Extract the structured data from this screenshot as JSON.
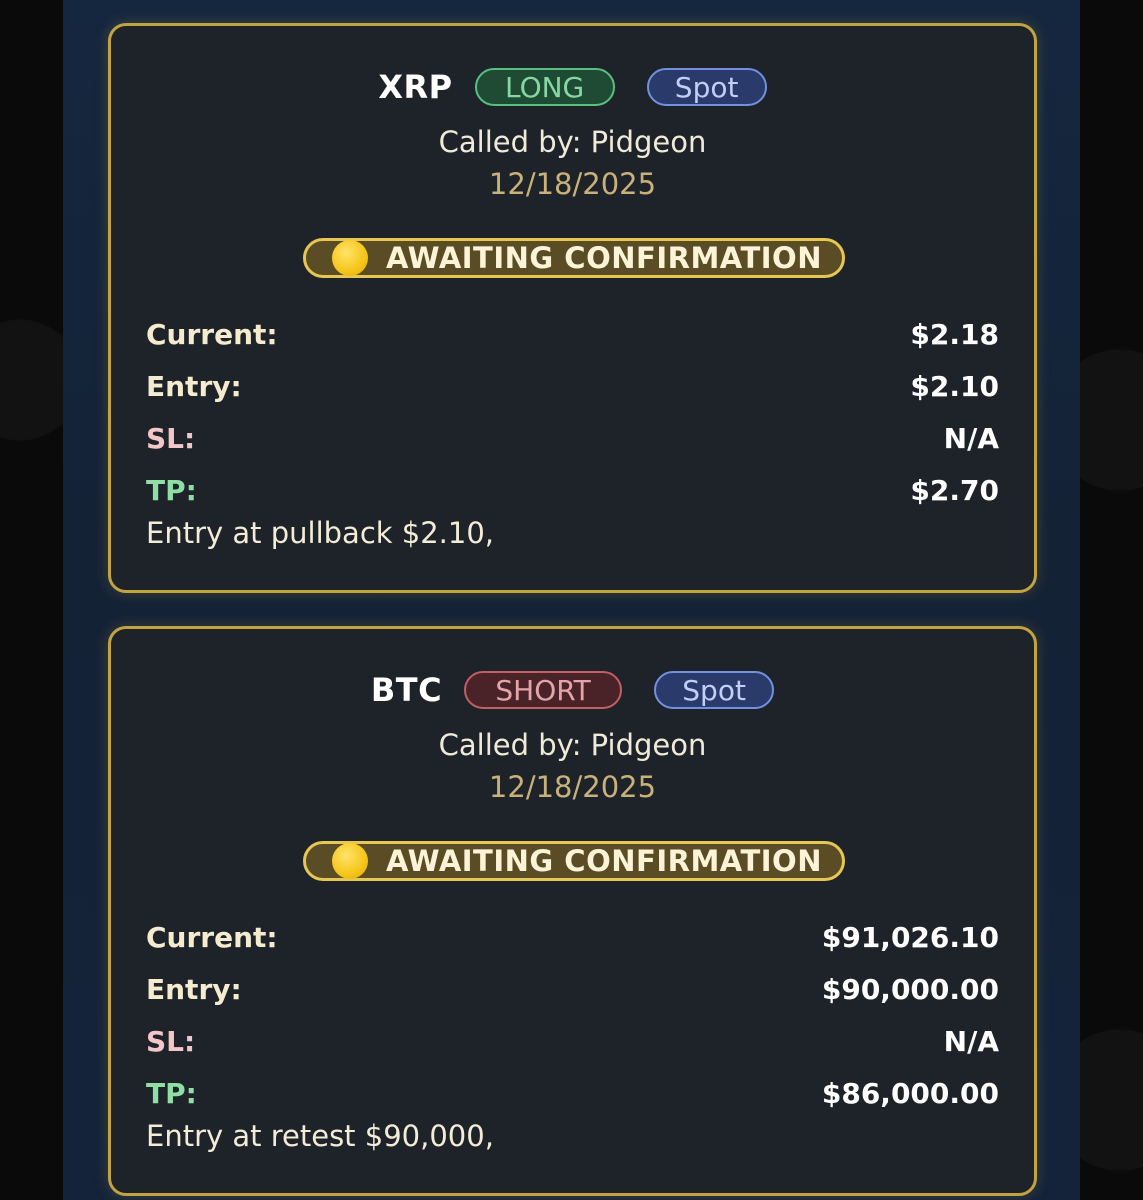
{
  "signals": [
    {
      "symbol": "XRP",
      "direction": "LONG",
      "market": "Spot",
      "called_by": "Called by: Pidgeon",
      "date": "12/18/2025",
      "status": "AWAITING CONFIRMATION",
      "labels": {
        "current": "Current:",
        "entry": "Entry:",
        "sl": "SL:",
        "tp": "TP:"
      },
      "values": {
        "current": "$2.18",
        "entry": "$2.10",
        "sl": "N/A",
        "tp": "$2.70"
      },
      "note": "Entry at pullback $2.10,"
    },
    {
      "symbol": "BTC",
      "direction": "SHORT",
      "market": "Spot",
      "called_by": "Called by: Pidgeon",
      "date": "12/18/2025",
      "status": "AWAITING CONFIRMATION",
      "labels": {
        "current": "Current:",
        "entry": "Entry:",
        "sl": "SL:",
        "tp": "TP:"
      },
      "values": {
        "current": "$91,026.10",
        "entry": "$90,000.00",
        "sl": "N/A",
        "tp": "$86,000.00"
      },
      "note": "Entry at retest $90,000,"
    }
  ],
  "icons": {
    "status_indicator": "yellow-circle-icon"
  },
  "colors": {
    "card_border": "#c2a341",
    "long": "#58c081",
    "short": "#c25e65",
    "spot": "#7191e0",
    "status": "#e7c653"
  }
}
